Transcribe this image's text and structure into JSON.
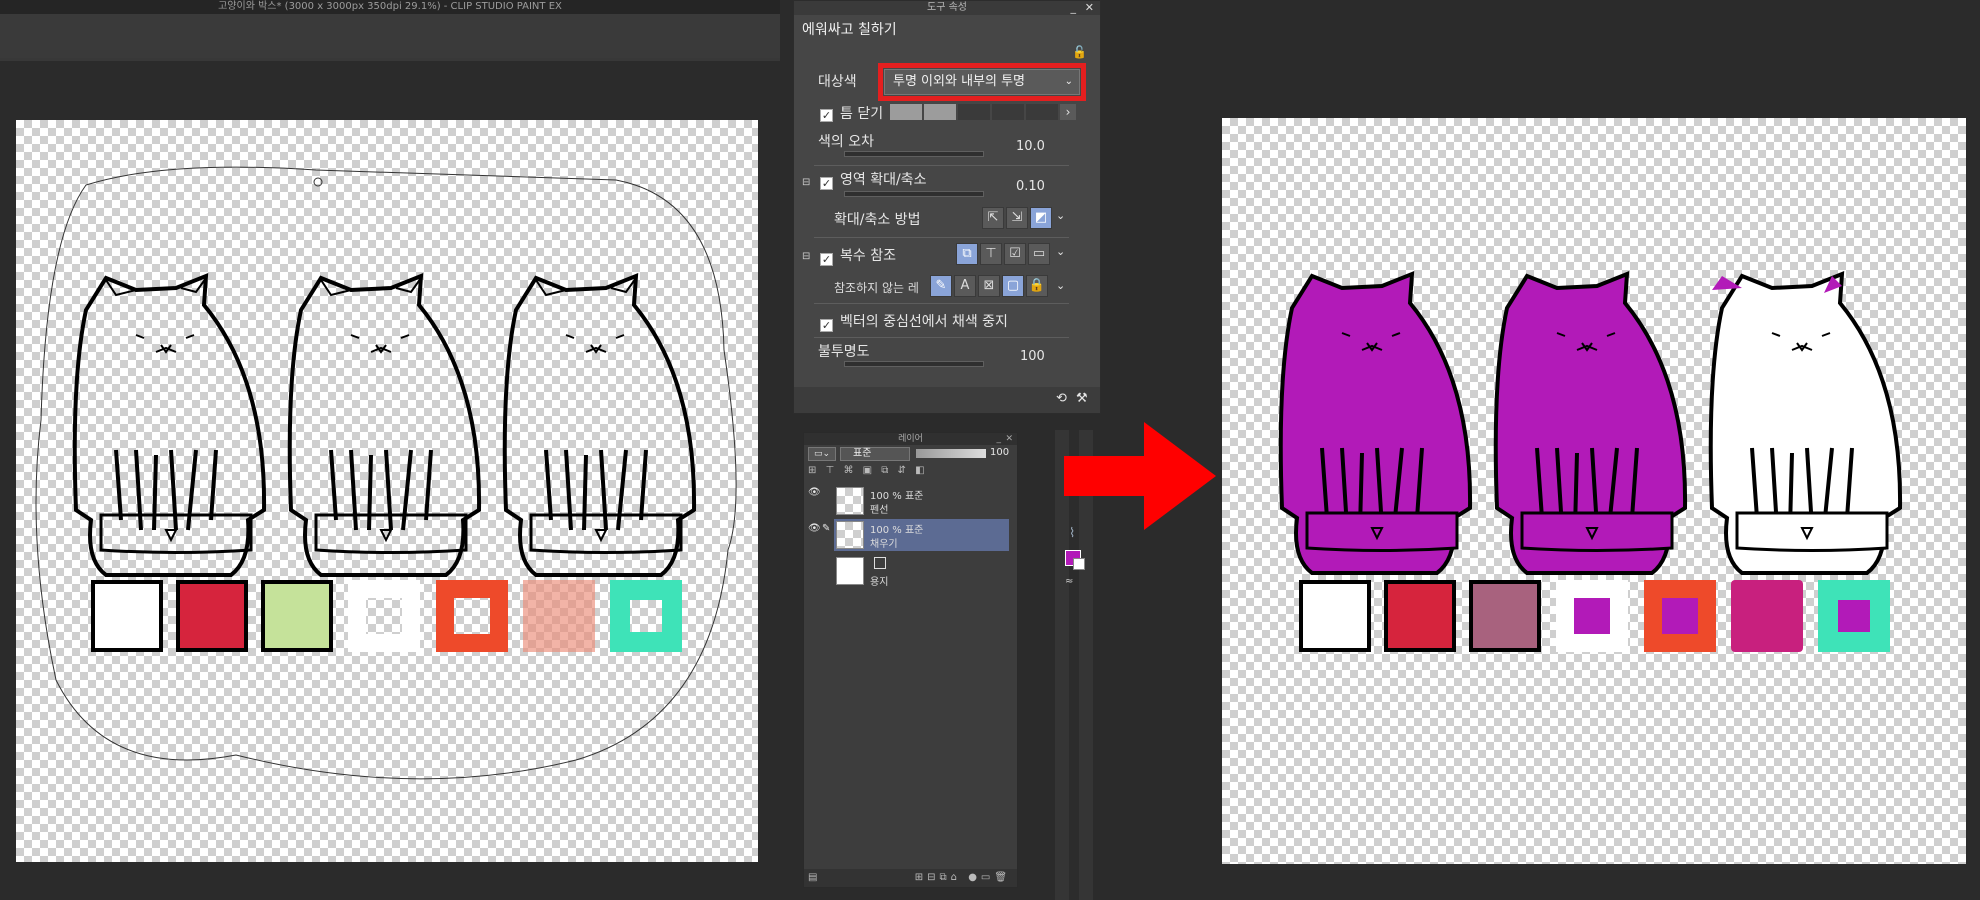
{
  "window": {
    "title": "고양이와 박스* (3000 x 3000px 350dpi 29.1%)  - CLIP STUDIO PAINT EX"
  },
  "tool_panel": {
    "header": "도구 속성",
    "title": "에워싸고 칠하기",
    "target_label": "대상색",
    "target_value": "투명 이외와 내부의 투명",
    "gap_label": "틈 닫기",
    "tolerance_label": "색의 오차",
    "tolerance_value": "10.0",
    "expand_label": "영역 확대/축소",
    "expand_value": "0.10",
    "expand_method_label": "확대/축소 방법",
    "multi_ref_label": "복수 참조",
    "not_ref_label": "참조하지 않는 레",
    "vector_label": "벡터의 중심선에서 채색 중지",
    "opacity_label": "불투명도",
    "opacity_value": "100"
  },
  "layer_panel": {
    "header": "레이어",
    "blend": "표준",
    "opacity": "100",
    "layers": [
      {
        "mode": "100 % 표준",
        "name": "펜선",
        "selected": false
      },
      {
        "mode": "100 % 표준",
        "name": "채우기",
        "selected": true
      },
      {
        "mode": "",
        "name": "용지",
        "selected": false
      }
    ]
  },
  "colors": {
    "fill": "#b21ab8",
    "highlight_box": "#e41f1f",
    "arrow": "#ff0000"
  },
  "icons": [
    "lock-icon",
    "chevron-down-icon",
    "chevron-right-icon",
    "eye-icon",
    "pen-icon",
    "collapse-icon",
    "arrow-right-icon"
  ]
}
